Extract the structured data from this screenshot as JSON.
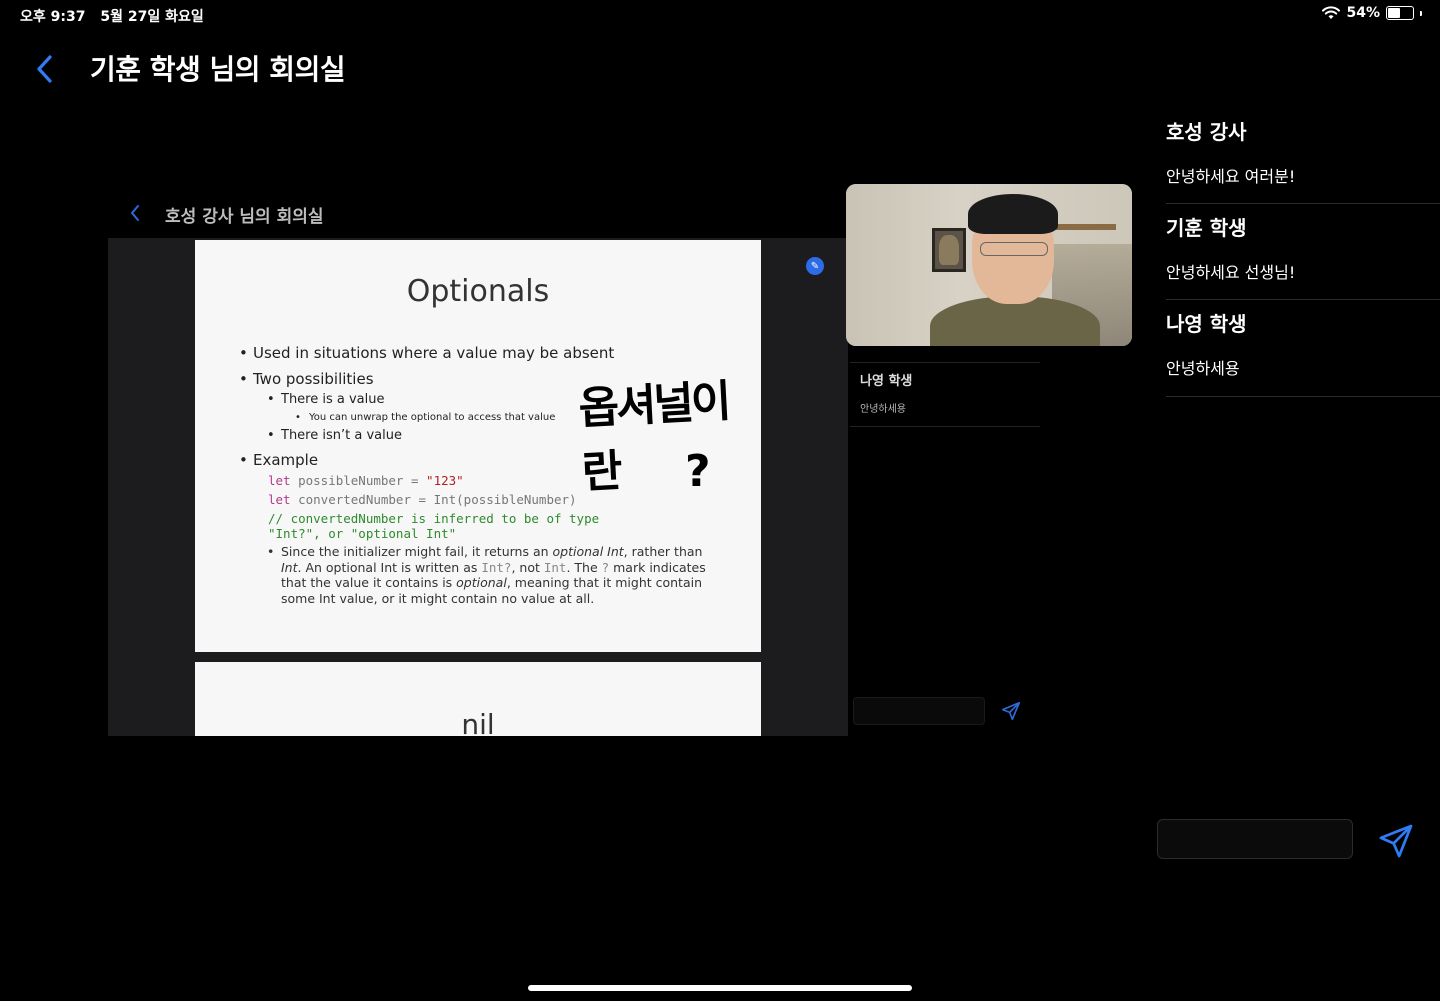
{
  "status_bar": {
    "time": "오후 9:37",
    "date": "5월 27일 화요일",
    "battery": "54%",
    "battery_level": 0.54
  },
  "header": {
    "title": "기훈 학생 님의 회의실"
  },
  "shared_screen": {
    "title": "호성 강사 님의 회의실",
    "slide": {
      "title": "Optionals",
      "bullets": [
        "Used in situations where a value may be absent",
        "Two possibilities",
        "There is a value",
        "You can unwrap the optional to access that value",
        "There isn’t a value",
        "Example"
      ],
      "code": {
        "line1_kw": "let",
        "line1_rest": " possibleNumber = ",
        "line1_str": "\"123\"",
        "line2_kw": "let",
        "line2_rest": " convertedNumber = Int(possibleNumber)",
        "line3": "// convertedNumber is inferred to be of type",
        "line4": "\"Int?\", or \"optional Int\""
      },
      "para": {
        "p1": "Since the initializer might fail, it returns an ",
        "p1_em": "optional Int",
        "p2": ", rather than ",
        "p2_em": "Int",
        "p3": ". An optional Int is written as ",
        "p3_code": "Int?",
        "p4": ", not ",
        "p4_code": "Int",
        "p5": ". The ",
        "p5_code": "?",
        "p6": " mark indicates that the value it contains is ",
        "p6_em": "optional",
        "p7": ", meaning that it might contain some Int value, or it might contain no value at all."
      },
      "handwriting": "옵셔널이란",
      "handwriting_q": "?"
    },
    "next_slide_title": "nil",
    "chat": {
      "name": "나영 학생",
      "message": "안녕하세용"
    }
  },
  "chat": {
    "messages": [
      {
        "name": "호성 강사",
        "text": "안녕하세요 여러분!"
      },
      {
        "name": "기훈 학생",
        "text": "안녕하세요 선생님!"
      },
      {
        "name": "나영 학생",
        "text": "안녕하세용"
      }
    ],
    "input_placeholder": ""
  },
  "colors": {
    "accent": "#2f7cf6",
    "background": "#000000"
  }
}
